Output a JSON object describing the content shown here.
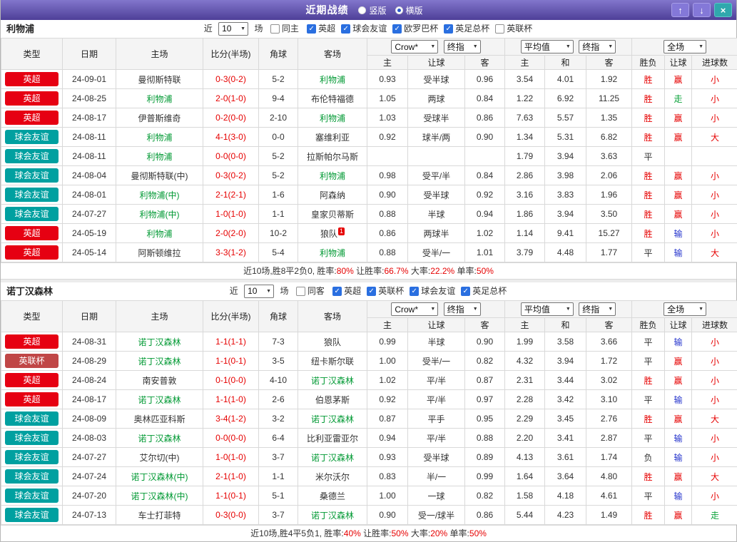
{
  "header": {
    "title": "近期战绩",
    "radio_vertical": "竖版",
    "radio_horizontal": "横版"
  },
  "icons": {
    "up": "↑",
    "down": "↓",
    "close": "×",
    "chevron": "▼",
    "check": "✓"
  },
  "colors": {
    "epl": "#e60012",
    "friendly": "#00a0a0",
    "eflcup": "#c04646",
    "red": "#e60000",
    "blue": "#2433cc",
    "green": "#0da33c",
    "dark": "#333333",
    "teamgreen": "#009933"
  },
  "columns": {
    "main": [
      "类型",
      "日期",
      "主场",
      "比分(半场)",
      "角球",
      "客场"
    ],
    "dd_book": "Crow*",
    "dd_final1": "终指",
    "dd_avg": "平均值",
    "dd_final2": "终指",
    "dd_scope": "全场",
    "g1": [
      "主",
      "让球",
      "客"
    ],
    "g2": [
      "主",
      "和",
      "客"
    ],
    "g3": [
      "胜负",
      "让球",
      "进球数"
    ]
  },
  "sections": [
    {
      "team": "利物浦",
      "filter": {
        "near_label": "近",
        "count": "10",
        "games_label": "场",
        "same_label": "同主",
        "same_checked": false,
        "leagues": [
          {
            "label": "英超",
            "checked": true
          },
          {
            "label": "球会友谊",
            "checked": true
          },
          {
            "label": "欧罗巴杯",
            "checked": true
          },
          {
            "label": "英足总杯",
            "checked": true
          },
          {
            "label": "英联杯",
            "checked": false
          }
        ]
      },
      "rows": [
        {
          "league": "英超",
          "badge": "epl",
          "date": "24-09-01",
          "home": "曼彻斯特联",
          "home_focus": false,
          "score": "0-3(0-2)",
          "corners": "5-2",
          "away": "利物浦",
          "away_focus": true,
          "ah_home": "0.93",
          "ah_line": "受半球",
          "ah_away": "0.96",
          "eu_home": "3.54",
          "eu_draw": "4.01",
          "eu_away": "1.92",
          "wdl": "胜",
          "wdl_c": "red",
          "ah_res": "赢",
          "ah_res_c": "red",
          "ou_res": "小",
          "ou_res_c": "red"
        },
        {
          "league": "英超",
          "badge": "epl",
          "date": "24-08-25",
          "home": "利物浦",
          "home_focus": true,
          "score": "2-0(1-0)",
          "corners": "9-4",
          "away": "布伦特福德",
          "away_focus": false,
          "ah_home": "1.05",
          "ah_line": "两球",
          "ah_away": "0.84",
          "eu_home": "1.22",
          "eu_draw": "6.92",
          "eu_away": "11.25",
          "wdl": "胜",
          "wdl_c": "red",
          "ah_res": "走",
          "ah_res_c": "green",
          "ou_res": "小",
          "ou_res_c": "red"
        },
        {
          "league": "英超",
          "badge": "epl",
          "date": "24-08-17",
          "home": "伊普斯维奇",
          "home_focus": false,
          "score": "0-2(0-0)",
          "corners": "2-10",
          "away": "利物浦",
          "away_focus": true,
          "ah_home": "1.03",
          "ah_line": "受球半",
          "ah_away": "0.86",
          "eu_home": "7.63",
          "eu_draw": "5.57",
          "eu_away": "1.35",
          "wdl": "胜",
          "wdl_c": "red",
          "ah_res": "赢",
          "ah_res_c": "red",
          "ou_res": "小",
          "ou_res_c": "red"
        },
        {
          "league": "球会友谊",
          "badge": "friendly",
          "date": "24-08-11",
          "home": "利物浦",
          "home_focus": true,
          "score": "4-1(3-0)",
          "corners": "0-0",
          "away": "塞维利亚",
          "away_focus": false,
          "ah_home": "0.92",
          "ah_line": "球半/两",
          "ah_away": "0.90",
          "eu_home": "1.34",
          "eu_draw": "5.31",
          "eu_away": "6.82",
          "wdl": "胜",
          "wdl_c": "red",
          "ah_res": "赢",
          "ah_res_c": "red",
          "ou_res": "大",
          "ou_res_c": "red"
        },
        {
          "league": "球会友谊",
          "badge": "friendly",
          "date": "24-08-11",
          "home": "利物浦",
          "home_focus": true,
          "score": "0-0(0-0)",
          "corners": "5-2",
          "away": "拉斯帕尔马斯",
          "away_focus": false,
          "ah_home": "",
          "ah_line": "",
          "ah_away": "",
          "eu_home": "1.79",
          "eu_draw": "3.94",
          "eu_away": "3.63",
          "wdl": "平",
          "wdl_c": "dark",
          "ah_res": "",
          "ah_res_c": "dark",
          "ou_res": "",
          "ou_res_c": "dark"
        },
        {
          "league": "球会友谊",
          "badge": "friendly",
          "date": "24-08-04",
          "home": "曼彻斯特联(中)",
          "home_focus": false,
          "score": "0-3(0-2)",
          "corners": "5-2",
          "away": "利物浦",
          "away_focus": true,
          "ah_home": "0.98",
          "ah_line": "受平/半",
          "ah_away": "0.84",
          "eu_home": "2.86",
          "eu_draw": "3.98",
          "eu_away": "2.06",
          "wdl": "胜",
          "wdl_c": "red",
          "ah_res": "赢",
          "ah_res_c": "red",
          "ou_res": "小",
          "ou_res_c": "red"
        },
        {
          "league": "球会友谊",
          "badge": "friendly",
          "date": "24-08-01",
          "home": "利物浦(中)",
          "home_focus": true,
          "score": "2-1(2-1)",
          "corners": "1-6",
          "away": "阿森纳",
          "away_focus": false,
          "ah_home": "0.90",
          "ah_line": "受半球",
          "ah_away": "0.92",
          "eu_home": "3.16",
          "eu_draw": "3.83",
          "eu_away": "1.96",
          "wdl": "胜",
          "wdl_c": "red",
          "ah_res": "赢",
          "ah_res_c": "red",
          "ou_res": "小",
          "ou_res_c": "red"
        },
        {
          "league": "球会友谊",
          "badge": "friendly",
          "date": "24-07-27",
          "home": "利物浦(中)",
          "home_focus": true,
          "score": "1-0(1-0)",
          "corners": "1-1",
          "away": "皇家贝蒂斯",
          "away_focus": false,
          "ah_home": "0.88",
          "ah_line": "半球",
          "ah_away": "0.94",
          "eu_home": "1.86",
          "eu_draw": "3.94",
          "eu_away": "3.50",
          "wdl": "胜",
          "wdl_c": "red",
          "ah_res": "赢",
          "ah_res_c": "red",
          "ou_res": "小",
          "ou_res_c": "red"
        },
        {
          "league": "英超",
          "badge": "epl",
          "date": "24-05-19",
          "home": "利物浦",
          "home_focus": true,
          "score": "2-0(2-0)",
          "corners": "10-2",
          "away": "狼队",
          "away_focus": false,
          "away_sup": "1",
          "ah_home": "0.86",
          "ah_line": "两球半",
          "ah_away": "1.02",
          "eu_home": "1.14",
          "eu_draw": "9.41",
          "eu_away": "15.27",
          "wdl": "胜",
          "wdl_c": "red",
          "ah_res": "输",
          "ah_res_c": "blue",
          "ou_res": "小",
          "ou_res_c": "red"
        },
        {
          "league": "英超",
          "badge": "epl",
          "date": "24-05-14",
          "home": "阿斯顿维拉",
          "home_focus": false,
          "score": "3-3(1-2)",
          "corners": "5-4",
          "away": "利物浦",
          "away_focus": true,
          "ah_home": "0.88",
          "ah_line": "受半/一",
          "ah_away": "1.01",
          "eu_home": "3.79",
          "eu_draw": "4.48",
          "eu_away": "1.77",
          "wdl": "平",
          "wdl_c": "dark",
          "ah_res": "输",
          "ah_res_c": "blue",
          "ou_res": "大",
          "ou_res_c": "red"
        }
      ],
      "summary": [
        {
          "text": "近10场,胜8平2负0, 胜率:",
          "red": false
        },
        {
          "text": "80%",
          "red": true
        },
        {
          "text": " 让胜率:",
          "red": false
        },
        {
          "text": "66.7%",
          "red": true
        },
        {
          "text": " 大率:",
          "red": false
        },
        {
          "text": "22.2%",
          "red": true
        },
        {
          "text": " 单率:",
          "red": false
        },
        {
          "text": "50%",
          "red": true
        }
      ]
    },
    {
      "team": "诺丁汉森林",
      "filter": {
        "near_label": "近",
        "count": "10",
        "games_label": "场",
        "same_label": "同客",
        "same_checked": false,
        "leagues": [
          {
            "label": "英超",
            "checked": true
          },
          {
            "label": "英联杯",
            "checked": true
          },
          {
            "label": "球会友谊",
            "checked": true
          },
          {
            "label": "英足总杯",
            "checked": true
          }
        ]
      },
      "rows": [
        {
          "league": "英超",
          "badge": "epl",
          "date": "24-08-31",
          "home": "诺丁汉森林",
          "home_focus": true,
          "score": "1-1(1-1)",
          "corners": "7-3",
          "away": "狼队",
          "away_focus": false,
          "ah_home": "0.99",
          "ah_line": "半球",
          "ah_away": "0.90",
          "eu_home": "1.99",
          "eu_draw": "3.58",
          "eu_away": "3.66",
          "wdl": "平",
          "wdl_c": "dark",
          "ah_res": "输",
          "ah_res_c": "blue",
          "ou_res": "小",
          "ou_res_c": "red"
        },
        {
          "league": "英联杯",
          "badge": "eflcup",
          "date": "24-08-29",
          "home": "诺丁汉森林",
          "home_focus": true,
          "score": "1-1(0-1)",
          "corners": "3-5",
          "away": "纽卡斯尔联",
          "away_focus": false,
          "ah_home": "1.00",
          "ah_line": "受半/一",
          "ah_away": "0.82",
          "eu_home": "4.32",
          "eu_draw": "3.94",
          "eu_away": "1.72",
          "wdl": "平",
          "wdl_c": "dark",
          "ah_res": "赢",
          "ah_res_c": "red",
          "ou_res": "小",
          "ou_res_c": "red"
        },
        {
          "league": "英超",
          "badge": "epl",
          "date": "24-08-24",
          "home": "南安普敦",
          "home_focus": false,
          "score": "0-1(0-0)",
          "corners": "4-10",
          "away": "诺丁汉森林",
          "away_focus": true,
          "ah_home": "1.02",
          "ah_line": "平/半",
          "ah_away": "0.87",
          "eu_home": "2.31",
          "eu_draw": "3.44",
          "eu_away": "3.02",
          "wdl": "胜",
          "wdl_c": "red",
          "ah_res": "赢",
          "ah_res_c": "red",
          "ou_res": "小",
          "ou_res_c": "red"
        },
        {
          "league": "英超",
          "badge": "epl",
          "date": "24-08-17",
          "home": "诺丁汉森林",
          "home_focus": true,
          "score": "1-1(1-0)",
          "corners": "2-6",
          "away": "伯恩茅斯",
          "away_focus": false,
          "ah_home": "0.92",
          "ah_line": "平/半",
          "ah_away": "0.97",
          "eu_home": "2.28",
          "eu_draw": "3.42",
          "eu_away": "3.10",
          "wdl": "平",
          "wdl_c": "dark",
          "ah_res": "输",
          "ah_res_c": "blue",
          "ou_res": "小",
          "ou_res_c": "red"
        },
        {
          "league": "球会友谊",
          "badge": "friendly",
          "date": "24-08-09",
          "home": "奥林匹亚科斯",
          "home_focus": false,
          "score": "3-4(1-2)",
          "corners": "3-2",
          "away": "诺丁汉森林",
          "away_focus": true,
          "ah_home": "0.87",
          "ah_line": "平手",
          "ah_away": "0.95",
          "eu_home": "2.29",
          "eu_draw": "3.45",
          "eu_away": "2.76",
          "wdl": "胜",
          "wdl_c": "red",
          "ah_res": "赢",
          "ah_res_c": "red",
          "ou_res": "大",
          "ou_res_c": "red"
        },
        {
          "league": "球会友谊",
          "badge": "friendly",
          "date": "24-08-03",
          "home": "诺丁汉森林",
          "home_focus": true,
          "score": "0-0(0-0)",
          "corners": "6-4",
          "away": "比利亚雷亚尔",
          "away_focus": false,
          "ah_home": "0.94",
          "ah_line": "平/半",
          "ah_away": "0.88",
          "eu_home": "2.20",
          "eu_draw": "3.41",
          "eu_away": "2.87",
          "wdl": "平",
          "wdl_c": "dark",
          "ah_res": "输",
          "ah_res_c": "blue",
          "ou_res": "小",
          "ou_res_c": "red"
        },
        {
          "league": "球会友谊",
          "badge": "friendly",
          "date": "24-07-27",
          "home": "艾尔切(中)",
          "home_focus": false,
          "score": "1-0(1-0)",
          "corners": "3-7",
          "away": "诺丁汉森林",
          "away_focus": true,
          "ah_home": "0.93",
          "ah_line": "受半球",
          "ah_away": "0.89",
          "eu_home": "4.13",
          "eu_draw": "3.61",
          "eu_away": "1.74",
          "wdl": "负",
          "wdl_c": "dark",
          "ah_res": "输",
          "ah_res_c": "blue",
          "ou_res": "小",
          "ou_res_c": "red"
        },
        {
          "league": "球会友谊",
          "badge": "friendly",
          "date": "24-07-24",
          "home": "诺丁汉森林(中)",
          "home_focus": true,
          "score": "2-1(1-0)",
          "corners": "1-1",
          "away": "米尔沃尔",
          "away_focus": false,
          "ah_home": "0.83",
          "ah_line": "半/一",
          "ah_away": "0.99",
          "eu_home": "1.64",
          "eu_draw": "3.64",
          "eu_away": "4.80",
          "wdl": "胜",
          "wdl_c": "red",
          "ah_res": "赢",
          "ah_res_c": "red",
          "ou_res": "大",
          "ou_res_c": "red"
        },
        {
          "league": "球会友谊",
          "badge": "friendly",
          "date": "24-07-20",
          "home": "诺丁汉森林(中)",
          "home_focus": true,
          "score": "1-1(0-1)",
          "corners": "5-1",
          "away": "桑德兰",
          "away_focus": false,
          "ah_home": "1.00",
          "ah_line": "一球",
          "ah_away": "0.82",
          "eu_home": "1.58",
          "eu_draw": "4.18",
          "eu_away": "4.61",
          "wdl": "平",
          "wdl_c": "dark",
          "ah_res": "输",
          "ah_res_c": "blue",
          "ou_res": "小",
          "ou_res_c": "red"
        },
        {
          "league": "球会友谊",
          "badge": "friendly",
          "date": "24-07-13",
          "home": "车士打菲特",
          "home_focus": false,
          "score": "0-3(0-0)",
          "corners": "3-7",
          "away": "诺丁汉森林",
          "away_focus": true,
          "ah_home": "0.90",
          "ah_line": "受一/球半",
          "ah_away": "0.86",
          "eu_home": "5.44",
          "eu_draw": "4.23",
          "eu_away": "1.49",
          "wdl": "胜",
          "wdl_c": "red",
          "ah_res": "赢",
          "ah_res_c": "red",
          "ou_res": "走",
          "ou_res_c": "green"
        }
      ],
      "summary": [
        {
          "text": "近10场,胜4平5负1, 胜率:",
          "red": false
        },
        {
          "text": "40%",
          "red": true
        },
        {
          "text": " 让胜率:",
          "red": false
        },
        {
          "text": "50%",
          "red": true
        },
        {
          "text": " 大率:",
          "red": false
        },
        {
          "text": "20%",
          "red": true
        },
        {
          "text": " 单率:",
          "red": false
        },
        {
          "text": "50%",
          "red": true
        }
      ]
    }
  ]
}
